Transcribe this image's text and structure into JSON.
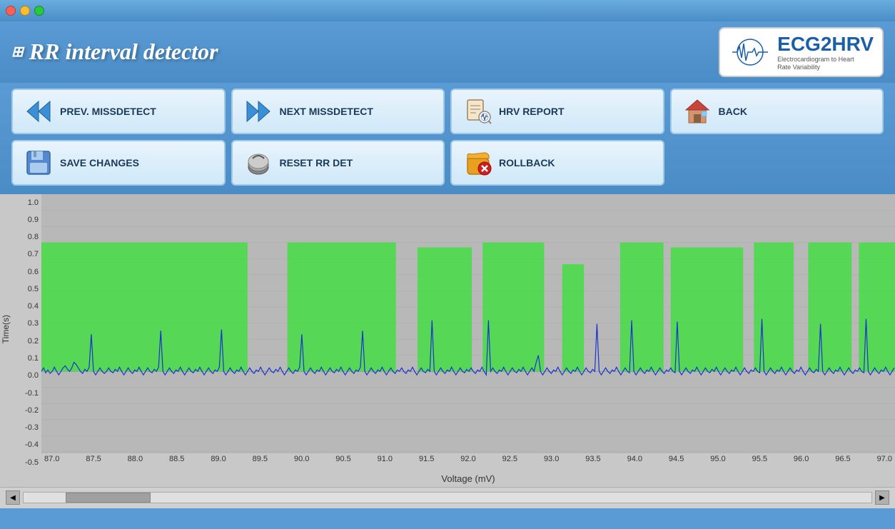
{
  "window": {
    "title": "RR interval detector"
  },
  "header": {
    "title": "RR interval detector",
    "logo_text": "ECG2HRV",
    "logo_subtext": "Electrocardiogram to Heart Rate Variability"
  },
  "toolbar": {
    "row1": [
      {
        "id": "prev-missdetect",
        "label": "PREV. MISSDETECT",
        "icon": "⏪"
      },
      {
        "id": "next-missdetect",
        "label": "NEXT MISSDETECT",
        "icon": "⏩"
      },
      {
        "id": "hrv-report",
        "label": "HRV REPORT",
        "icon": "📋"
      },
      {
        "id": "back",
        "label": "BACK",
        "icon": "🏠"
      }
    ],
    "row2": [
      {
        "id": "save-changes",
        "label": "SAVE CHANGES",
        "icon": "💾"
      },
      {
        "id": "reset-rr-det",
        "label": "RESET RR DET",
        "icon": "🔏"
      },
      {
        "id": "rollback",
        "label": "ROLLBACK",
        "icon": "📁"
      }
    ]
  },
  "chart": {
    "y_axis_label": "Time(s)",
    "x_axis_label": "Voltage (mV)",
    "y_ticks": [
      "1.0",
      "0.9",
      "0.8",
      "0.7",
      "0.6",
      "0.5",
      "0.4",
      "0.3",
      "0.2",
      "0.1",
      "0.0",
      "-0.1",
      "-0.2",
      "-0.3",
      "-0.4",
      "-0.5"
    ],
    "x_ticks": [
      "87.0",
      "87.5",
      "88.0",
      "88.5",
      "89.0",
      "89.5",
      "90.0",
      "90.5",
      "91.0",
      "91.5",
      "92.0",
      "92.5",
      "93.0",
      "93.5",
      "94.0",
      "94.5",
      "95.0",
      "95.5",
      "96.0",
      "96.5",
      "97.0"
    ]
  }
}
